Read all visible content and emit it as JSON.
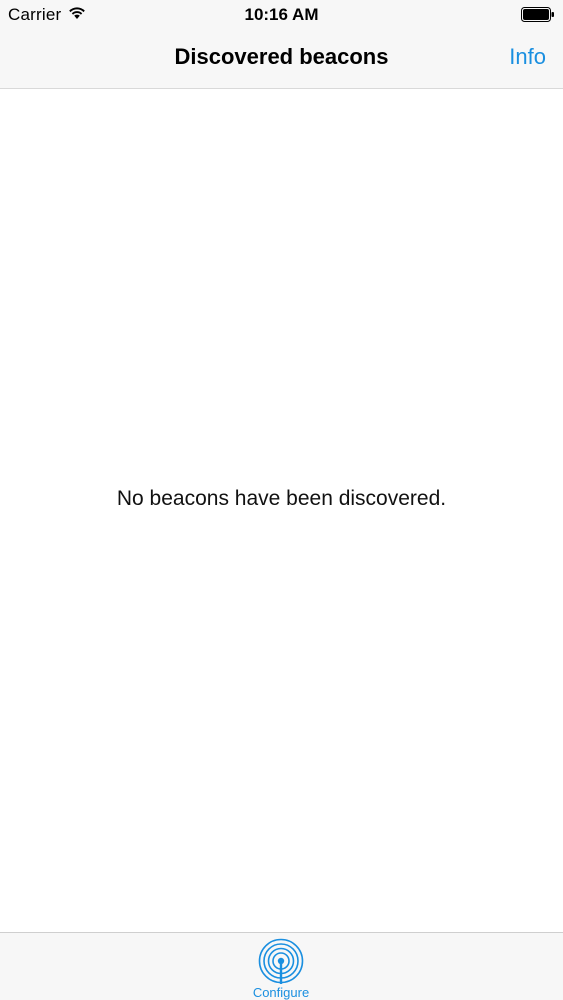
{
  "status_bar": {
    "carrier": "Carrier",
    "time": "10:16 AM",
    "wifi_icon": "wifi-icon",
    "battery_icon": "battery-icon"
  },
  "nav_bar": {
    "title": "Discovered beacons",
    "info_label": "Info"
  },
  "content": {
    "empty_message": "No beacons have been discovered."
  },
  "tab_bar": {
    "items": [
      {
        "label": "Configure",
        "icon": "beacon-signal-icon",
        "selected": true
      }
    ]
  },
  "colors": {
    "accent": "#1a8fe0",
    "chrome_background": "#f7f7f7",
    "content_background": "#ffffff"
  }
}
